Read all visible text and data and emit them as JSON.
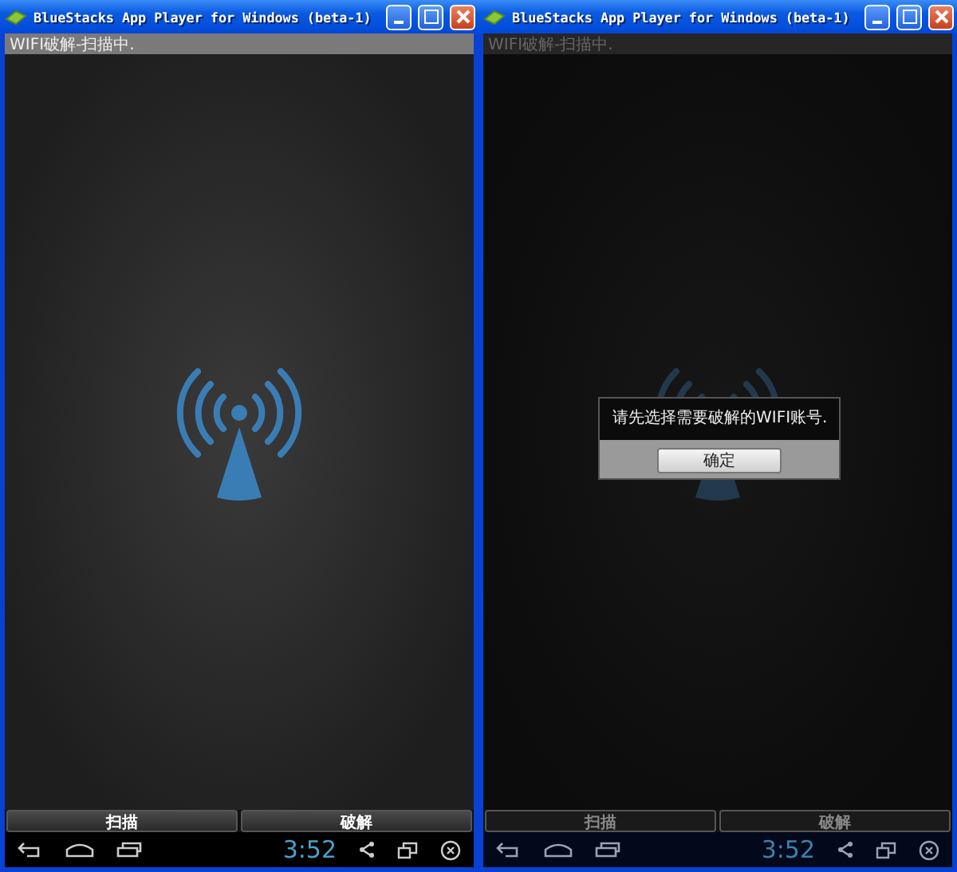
{
  "windows": [
    {
      "title": "BlueStacks App Player for Windows (beta-1)",
      "status_text": "WIFI破解-扫描中.",
      "dimmed": false,
      "buttons": [
        "扫描",
        "破解"
      ],
      "clock": "3:52"
    },
    {
      "title": "BlueStacks App Player for Windows (beta-1)",
      "status_text": "WIFI破解-扫描中.",
      "dimmed": true,
      "dialog": {
        "message": "请先选择需要破解的WIFI账号.",
        "button": "确定"
      },
      "buttons": [
        "扫描",
        "破解"
      ],
      "clock": "3:52"
    }
  ]
}
